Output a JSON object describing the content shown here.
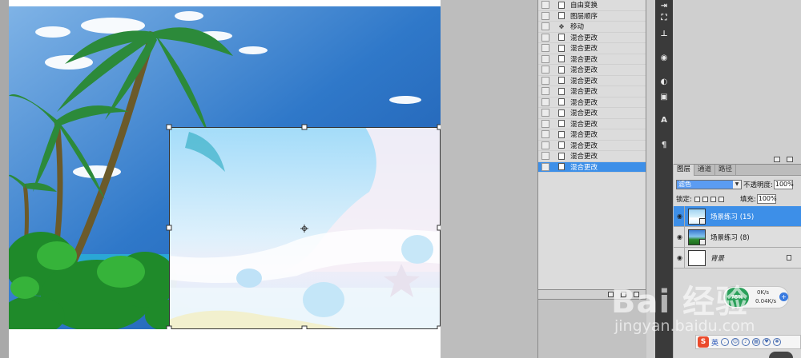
{
  "history": {
    "items": [
      {
        "label": "自由变换",
        "icon": "document-icon",
        "active": false
      },
      {
        "label": "图层顺序",
        "icon": "document-icon",
        "active": false
      },
      {
        "label": "移动",
        "icon": "move-icon",
        "active": false
      },
      {
        "label": "混合更改",
        "icon": "document-icon",
        "active": false
      },
      {
        "label": "混合更改",
        "icon": "document-icon",
        "active": false
      },
      {
        "label": "混合更改",
        "icon": "document-icon",
        "active": false
      },
      {
        "label": "混合更改",
        "icon": "document-icon",
        "active": false
      },
      {
        "label": "混合更改",
        "icon": "document-icon",
        "active": false
      },
      {
        "label": "混合更改",
        "icon": "document-icon",
        "active": false
      },
      {
        "label": "混合更改",
        "icon": "document-icon",
        "active": false
      },
      {
        "label": "混合更改",
        "icon": "document-icon",
        "active": false
      },
      {
        "label": "混合更改",
        "icon": "document-icon",
        "active": false
      },
      {
        "label": "混合更改",
        "icon": "document-icon",
        "active": false
      },
      {
        "label": "混合更改",
        "icon": "document-icon",
        "active": false
      },
      {
        "label": "混合更改",
        "icon": "document-icon",
        "active": false
      },
      {
        "label": "混合更改",
        "icon": "document-icon",
        "active": true
      }
    ]
  },
  "layers_panel": {
    "tabs": [
      "图层",
      "通道",
      "路径"
    ],
    "blend_mode": "滤色",
    "opacity_label": "不透明度:",
    "opacity_value": "100%",
    "lock_label": "锁定:",
    "fill_label": "填充:",
    "fill_value": "100%",
    "layers": [
      {
        "name": "场景练习 (15)",
        "active": true
      },
      {
        "name": "场景练习 (8)",
        "active": false
      },
      {
        "name": "背景",
        "active": false,
        "italic": true
      }
    ]
  },
  "speed_widget": {
    "percent": "76%",
    "upload": "0K/s",
    "download": "0.04K/s",
    "plus": "+"
  },
  "ime": {
    "logo": "S",
    "mode": "英"
  },
  "watermark": {
    "brand": "Bai 经验",
    "url": "jingyan.baidu.com"
  },
  "colors": {
    "selection_blue": "#3d8fe8",
    "panel_bg": "#d8d8d8",
    "sky_top": "#1a5fb4"
  }
}
